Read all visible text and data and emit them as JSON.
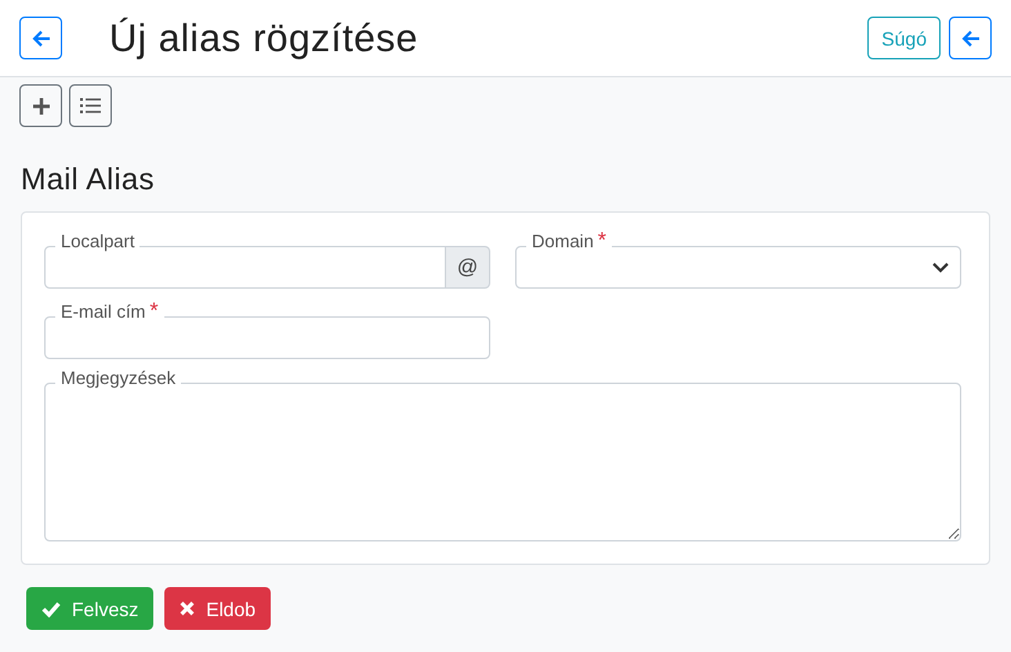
{
  "header": {
    "title": "Új alias rögzítése",
    "help_button": "Súgó"
  },
  "section_title": "Mail Alias",
  "fields": [
    {
      "kind": "addon-input",
      "label": "Localpart",
      "addon": "@"
    },
    {
      "kind": "select",
      "label": "Domain",
      "required_mark": "*"
    },
    {
      "kind": "input",
      "label": "E-mail cím",
      "required_mark": "*"
    },
    {
      "kind": "textarea",
      "label": "Megjegyzések"
    }
  ],
  "buttons": [
    {
      "kind": "save",
      "label": "Felvesz"
    },
    {
      "kind": "cancel",
      "label": "Eldob"
    }
  ]
}
